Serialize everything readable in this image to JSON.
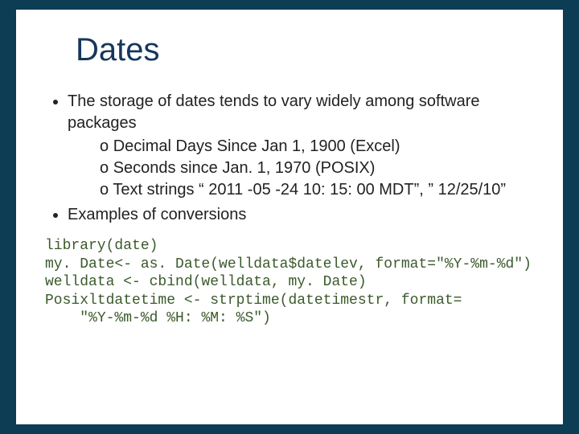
{
  "title": "Dates",
  "bullets": {
    "b1": "The storage of dates tends to vary widely among software packages",
    "sub": {
      "s1": "Decimal Days Since Jan 1, 1900 (Excel)",
      "s2": "Seconds since Jan. 1, 1970 (POSIX)",
      "s3": "Text strings “ 2011 -05 -24 10: 15: 00 MDT”, ” 12/25/10”"
    },
    "b2": "Examples of conversions"
  },
  "code": "library(date)\nmy. Date<- as. Date(welldata$datelev, format=\"%Y-%m-%d\")\nwelldata <- cbind(welldata, my. Date)\nPosixltdatetime <- strptime(datetimestr, format=\n    \"%Y-%m-%d %H: %M: %S\")"
}
